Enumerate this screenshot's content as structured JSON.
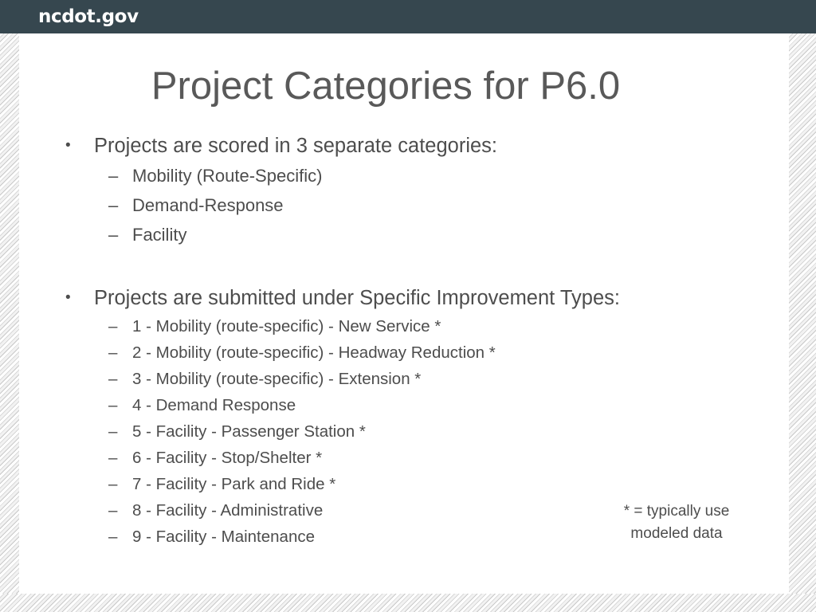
{
  "header": {
    "logo_text": "ncdot.gov",
    "bar_color": "#36474f"
  },
  "slide": {
    "title": "Project Categories for P6.0",
    "title_color": "#595959",
    "body_color": "#4d4d4d",
    "bullet_marker_l1": "•",
    "bullet_marker_l2": "–",
    "sections": [
      {
        "heading": "Projects are scored in 3 separate categories:",
        "items": [
          "Mobility (Route-Specific)",
          "Demand-Response",
          "Facility"
        ]
      },
      {
        "heading": "Projects are submitted under Specific Improvement Types:",
        "items": [
          "1 - Mobility (route-specific) - New Service *",
          "2 - Mobility (route-specific) - Headway Reduction *",
          "3 - Mobility (route-specific) - Extension *",
          "4 - Demand Response",
          "5 - Facility - Passenger Station *",
          "6 - Facility - Stop/Shelter *",
          "7 - Facility - Park and Ride *",
          "8 - Facility - Administrative",
          "9 - Facility - Maintenance"
        ]
      }
    ],
    "footnote_line1": "* = typically use",
    "footnote_line2": "modeled data"
  }
}
